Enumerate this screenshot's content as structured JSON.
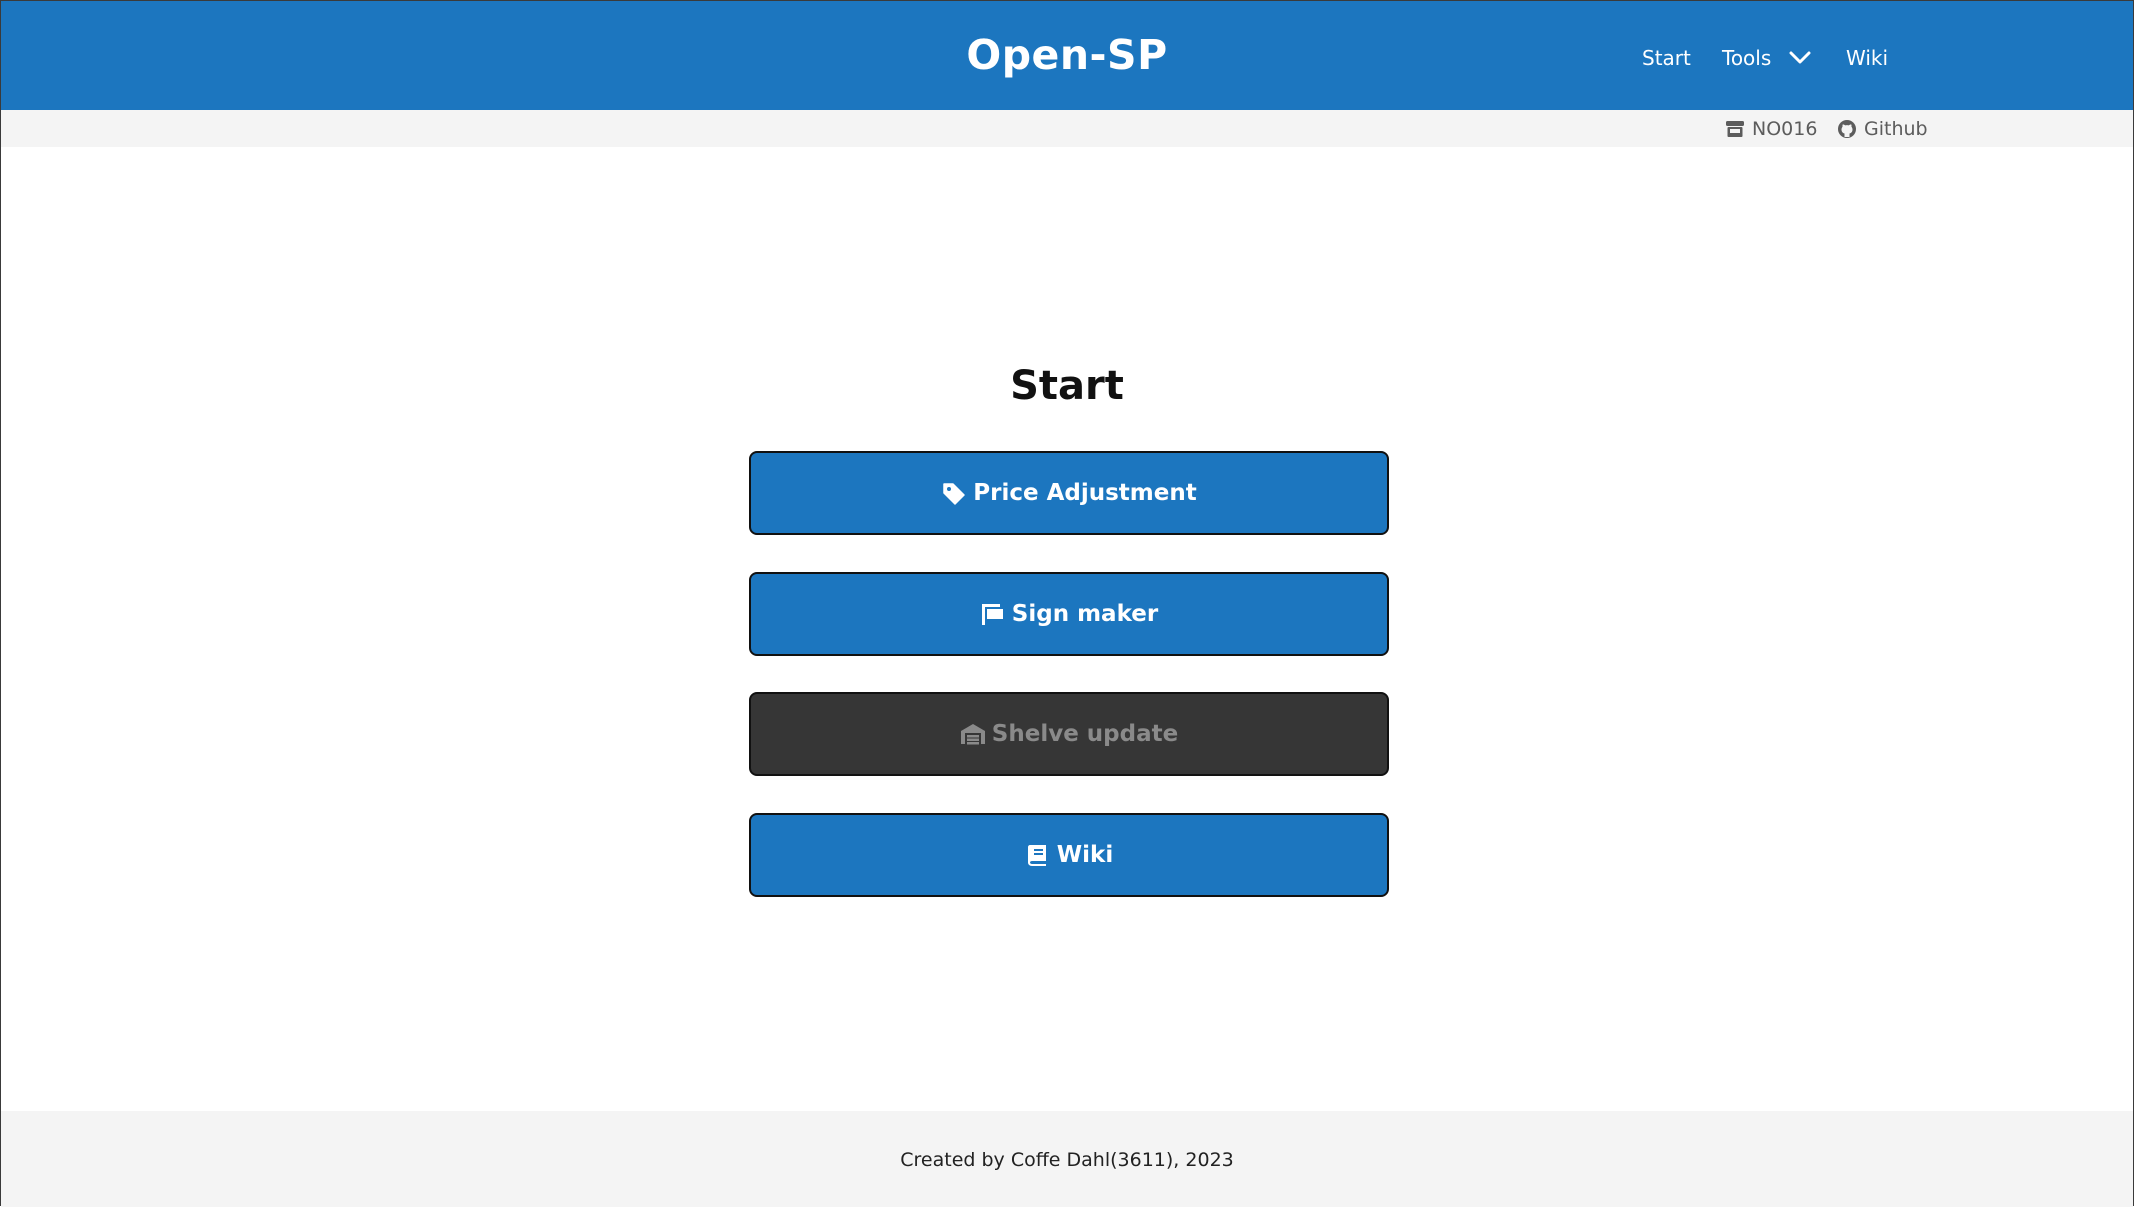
{
  "header": {
    "brand": "Open-SP",
    "nav": {
      "start": "Start",
      "tools": "Tools",
      "wiki": "Wiki"
    },
    "background_color": "#1c76bf"
  },
  "subbar": {
    "store_id": "NO016",
    "github": "Github"
  },
  "main": {
    "title": "Start",
    "buttons": [
      {
        "label": "Price Adjustment",
        "icon": "tag-icon",
        "enabled": true
      },
      {
        "label": "Sign maker",
        "icon": "sign-icon",
        "enabled": true
      },
      {
        "label": "Shelve update",
        "icon": "warehouse-icon",
        "enabled": false
      },
      {
        "label": "Wiki",
        "icon": "book-icon",
        "enabled": true
      }
    ]
  },
  "footer": {
    "text": "Created by Coffe Dahl(3611), 2023"
  },
  "colors": {
    "primary": "#1c76bf",
    "disabled": "#363636",
    "subbar": "#f4f4f4"
  }
}
